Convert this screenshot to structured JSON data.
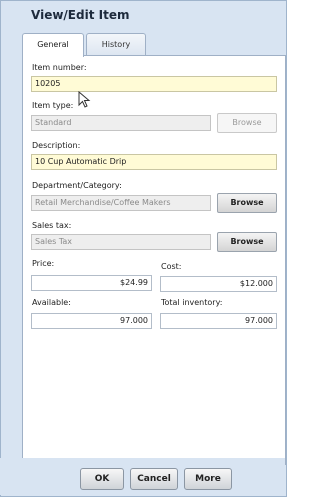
{
  "window": {
    "title": "View/Edit Item"
  },
  "tabs": [
    {
      "label": "General",
      "active": true
    },
    {
      "label": "History",
      "active": false
    }
  ],
  "fields": {
    "item_number": {
      "label": "Item number:",
      "value": "10205"
    },
    "item_type": {
      "label": "Item type:",
      "value": "Standard",
      "browse_label": "Browse"
    },
    "description": {
      "label": "Description:",
      "value": "10 Cup Automatic Drip"
    },
    "department": {
      "label": "Department/Category:",
      "value": "Retail Merchandise/Coffee Makers",
      "browse_label": "Browse"
    },
    "sales_tax": {
      "label": "Sales tax:",
      "value": "Sales Tax",
      "browse_label": "Browse"
    },
    "price": {
      "label": "Price:",
      "value": "$24.99"
    },
    "cost": {
      "label": "Cost:",
      "value": "$12.000"
    },
    "available": {
      "label": "Available:",
      "value": "97.000"
    },
    "total_inventory": {
      "label": "Total inventory:",
      "value": "97.000"
    }
  },
  "footer": {
    "ok_label": "OK",
    "cancel_label": "Cancel",
    "more_label": "More"
  },
  "colors": {
    "window_bg": "#d8e4f2",
    "highlight_field": "#fffbd6",
    "disabled_field": "#eeeeee"
  }
}
